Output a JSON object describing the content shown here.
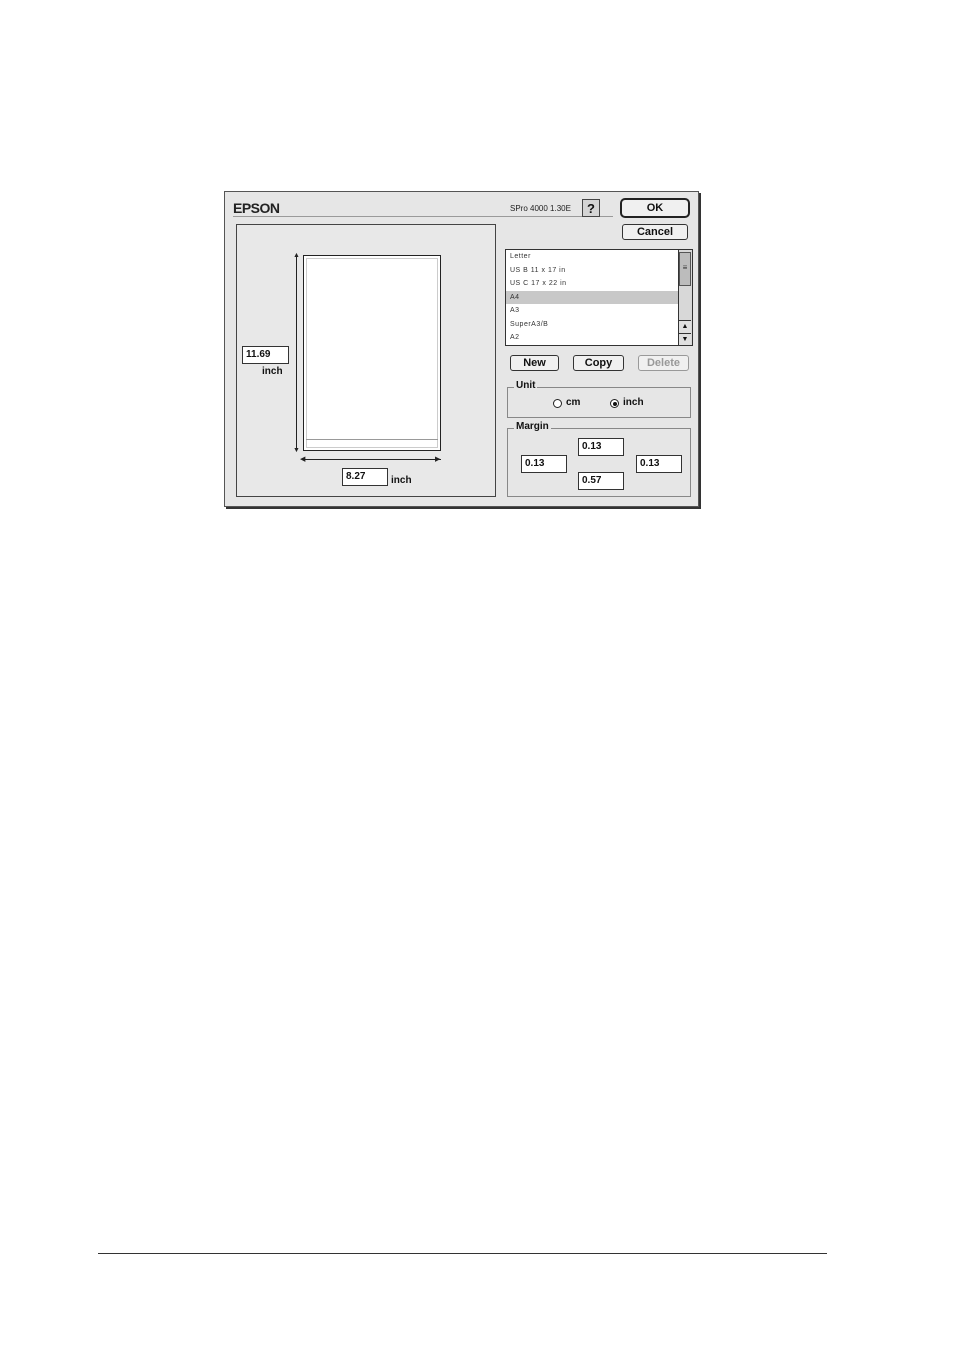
{
  "dialog": {
    "logo": "EPSON",
    "model": "SPro 4000 1.30E",
    "help_label": "?",
    "ok_label": "OK",
    "cancel_label": "Cancel"
  },
  "preview": {
    "height_value": "11.69",
    "height_unit": "inch",
    "width_value": "8.27",
    "width_unit": "inch"
  },
  "paper_list": {
    "items": [
      "Letter",
      "US B 11 x 17 in",
      "US C 17 x 22 in",
      "A4",
      "A3",
      "SuperA3/B",
      "A2"
    ],
    "selected": "A4"
  },
  "buttons": {
    "new_label": "New",
    "copy_label": "Copy",
    "delete_label": "Delete"
  },
  "unit": {
    "title": "Unit",
    "options": [
      "cm",
      "inch"
    ],
    "selected": "inch"
  },
  "margin": {
    "title": "Margin",
    "top": "0.13",
    "left": "0.13",
    "right": "0.13",
    "bottom": "0.57"
  },
  "icons": {
    "help": "help-icon",
    "scroll_up": "scroll-up-icon",
    "scroll_down": "scroll-down-icon"
  }
}
